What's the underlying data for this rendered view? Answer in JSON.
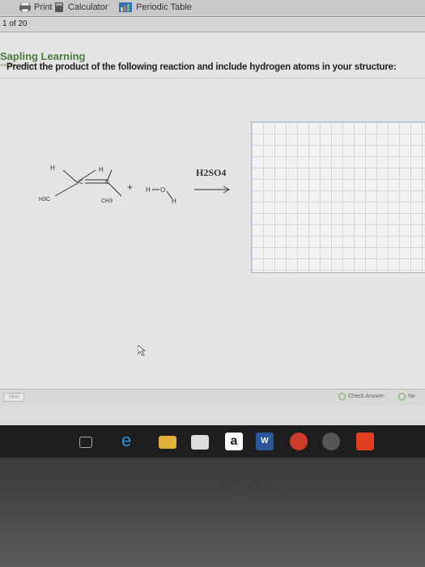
{
  "toolbar": {
    "items": [
      {
        "label": "Print",
        "icon": "printer-icon"
      },
      {
        "label": "Calculator",
        "icon": "calculator-icon"
      },
      {
        "label": "Periodic Table",
        "icon": "periodic-table-icon"
      }
    ]
  },
  "pager": {
    "text": "1 of 20"
  },
  "brand": {
    "name": "Sapling Learning",
    "sub": "macmillan learning",
    "color": "#4a7d3a"
  },
  "question": {
    "prompt": "Predict the product of the following reaction and include hydrogen atoms in your structure:"
  },
  "reaction": {
    "reactant1": {
      "labels": [
        "H",
        "H",
        "H3C",
        "CH3",
        "C",
        "C"
      ]
    },
    "plus": "+",
    "reactant2": {
      "labels": [
        "H",
        "O",
        "H"
      ]
    },
    "reagent": "H2SO4",
    "arrow": "→"
  },
  "bottom_bar": {
    "hint": "Hint",
    "check_answer": "Check Answer",
    "next": "Ne"
  },
  "taskbar": {
    "icons": [
      "task-view-icon",
      "edge-icon",
      "file-explorer-icon",
      "store-icon",
      "amazon-icon",
      "word-icon",
      "chrome-icon",
      "media-icon",
      "steam-icon"
    ]
  },
  "bezel": {
    "brand": "Inspiron"
  }
}
